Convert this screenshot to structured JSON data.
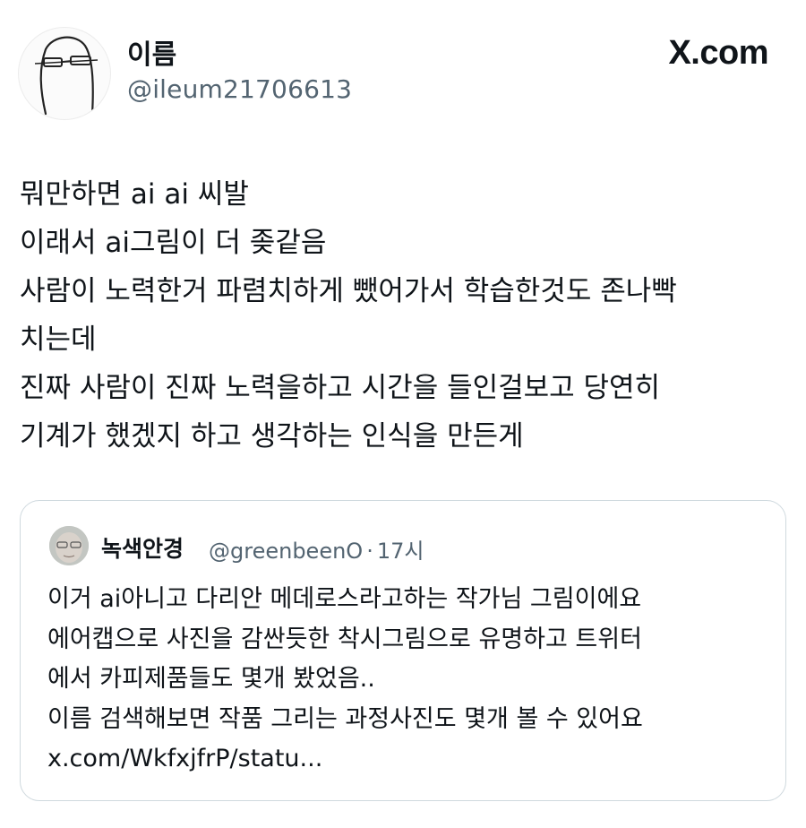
{
  "author": {
    "display_name": "이름",
    "handle": "@ileum21706613",
    "avatar_icon": "glasses-sketch-avatar"
  },
  "site": {
    "logo_text": "X.com"
  },
  "tweet": {
    "lines": [
      "뭐만하면 ai ai 씨발",
      "이래서 ai그림이 더 좆같음",
      "사람이 노력한거 파렴치하게 뺐어가서 학습한것도 존나빡",
      "치는데",
      "진짜 사람이 진짜 노력을하고 시간을 들인걸보고 당연히",
      "기계가 했겠지 하고 생각하는 인식을 만든게"
    ]
  },
  "quoted_tweet": {
    "display_name": "녹색안경",
    "handle": "@greenbeenO",
    "separator": "·",
    "time": "17시",
    "lines": [
      "이거 ai아니고 다리안 메데로스라고하는 작가님 그림이에요",
      "에어캡으로 사진을 감싼듯한 착시그림으로 유명하고 트위터",
      "에서 카피제품들도 몇개 봤었음..",
      "이름 검색해보면 작품 그리는 과정사진도 몇개 볼 수 있어요",
      "x.com/WkfxjfrP/statu..."
    ]
  },
  "colors": {
    "text": "#0f1419",
    "secondary": "#536471",
    "border": "#cfd9de"
  }
}
